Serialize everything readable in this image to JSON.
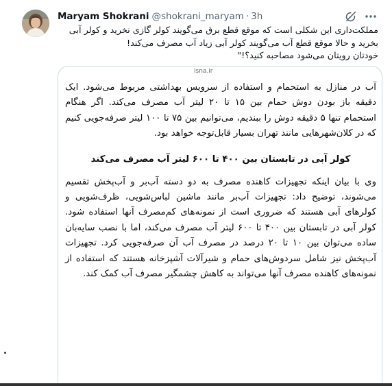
{
  "tweet": {
    "display_name": "Maryam Shokrani",
    "handle": "@shokrani_maryam",
    "separator": "·",
    "timestamp": "3h",
    "icons": {
      "avatar": "avatar-photo",
      "grok": "grok-slash-circle-icon",
      "more": "more-horizontal-icon"
    },
    "text_lines": [
      "مملکت‌داری این شکلی است که موقع قطع برق می‌گویند کولر گازی نخرید و کولر آبی",
      "بخرید و حالا موقع قطع آب می‌گویند کولر آبی زیاد آب مصرف می‌کند!",
      "خودتان رویتان می‌شود مصاحبه کنید؟!\""
    ]
  },
  "media": {
    "source": "isna.ir",
    "paragraph1": "آب در منازل به استحمام و استفاده از سرویس بهداشتی مربوط می‌شود. ایک دقیقه باز بودن دوش حمام بین ۱۵ تا ۲۰ لیتر آب مصرف می‌کند. اگر هنگام استحمام تنها ۵ دقیقه دوش را ببندیم، می‌توانیم بین ۷۵ تا ۱۰۰ لیتر صرفه‌جویی کنیم که در کلان‌شهرهایی مانند تهران بسیار قابل‌توجه خواهد بود.",
    "heading": "کولر آبی در تابستان بین ۴۰۰ تا ۶۰۰ لیتر آب مصرف می‌کند",
    "paragraph2": "وی با بیان اینکه تجهیزات کاهنده مصرف به دو دسته آب‌بر و آب‌پخش تقسیم می‌شوند، توضیح داد: تجهیزات آب‌بر مانند ماشین لباس‌شویی، ظرف‌شویی و کولرهای آبی هستند که ضروری است از نمونه‌های کم‌مصرف آنها استفاده شود. کولر آبی در تابستان بین ۴۰۰ تا ۶۰۰ لیتر آب مصرف می‌کند، اما با نصب سایه‌بان ساده می‌توان بین ۱۰ تا ۲۰ درصد در مصرف آب آن صرفه‌جویی کرد. تجهیزات آب‌پخش نیز شامل سردوش‌های حمام و شیرآلات آشپزخانه هستند که استفاده از نمونه‌های کاهنده مصرف آنها می‌تواند به کاهش چشمگیر مصرف آب کمک کند."
  },
  "colors": {
    "text_primary": "#0f1419",
    "text_secondary": "#536471",
    "border": "#cfd9de"
  }
}
